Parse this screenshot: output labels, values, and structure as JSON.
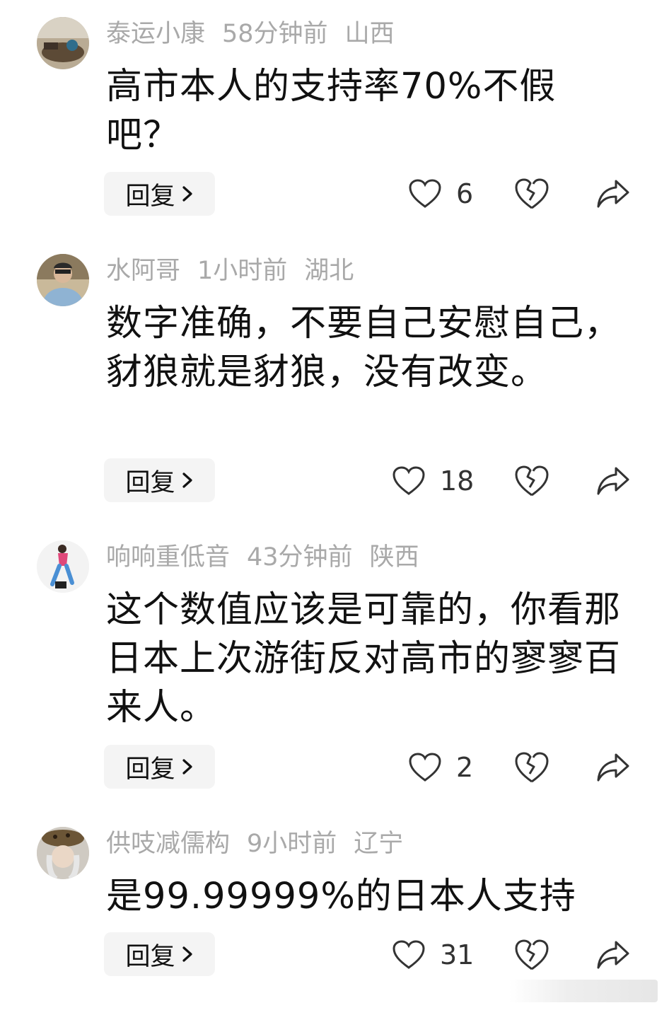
{
  "comments": [
    {
      "username": "泰运小康",
      "time": "58分钟前",
      "location": "山西",
      "text": "高市本人的支持率70%不假吧？",
      "reply_label": "回复",
      "likes": "6"
    },
    {
      "username": "水阿哥",
      "time": "1小时前",
      "location": "湖北",
      "text": "数字准确，不要自己安慰自己，豺狼就是豺狼，没有改变。",
      "reply_label": "回复",
      "likes": "18"
    },
    {
      "username": "响响重低音",
      "time": "43分钟前",
      "location": "陕西",
      "text": "这个数值应该是可靠的，你看那日本上次游街反对高市的寥寥百来人。",
      "reply_label": "回复",
      "likes": "2"
    },
    {
      "username": "供吱减儒构",
      "time": "9小时前",
      "location": "辽宁",
      "text": "是99.99999%的日本人支持",
      "reply_label": "回复",
      "likes": "31"
    }
  ],
  "icons": {
    "like": "heart-outline-icon",
    "dislike": "broken-heart-icon",
    "share": "share-arrow-icon",
    "reply_chevron": "chevron-right-icon"
  },
  "colors": {
    "meta_text": "#a9a9a9",
    "body_text": "#111111",
    "reply_bg": "#f4f4f4",
    "icon_stroke": "#333333"
  }
}
